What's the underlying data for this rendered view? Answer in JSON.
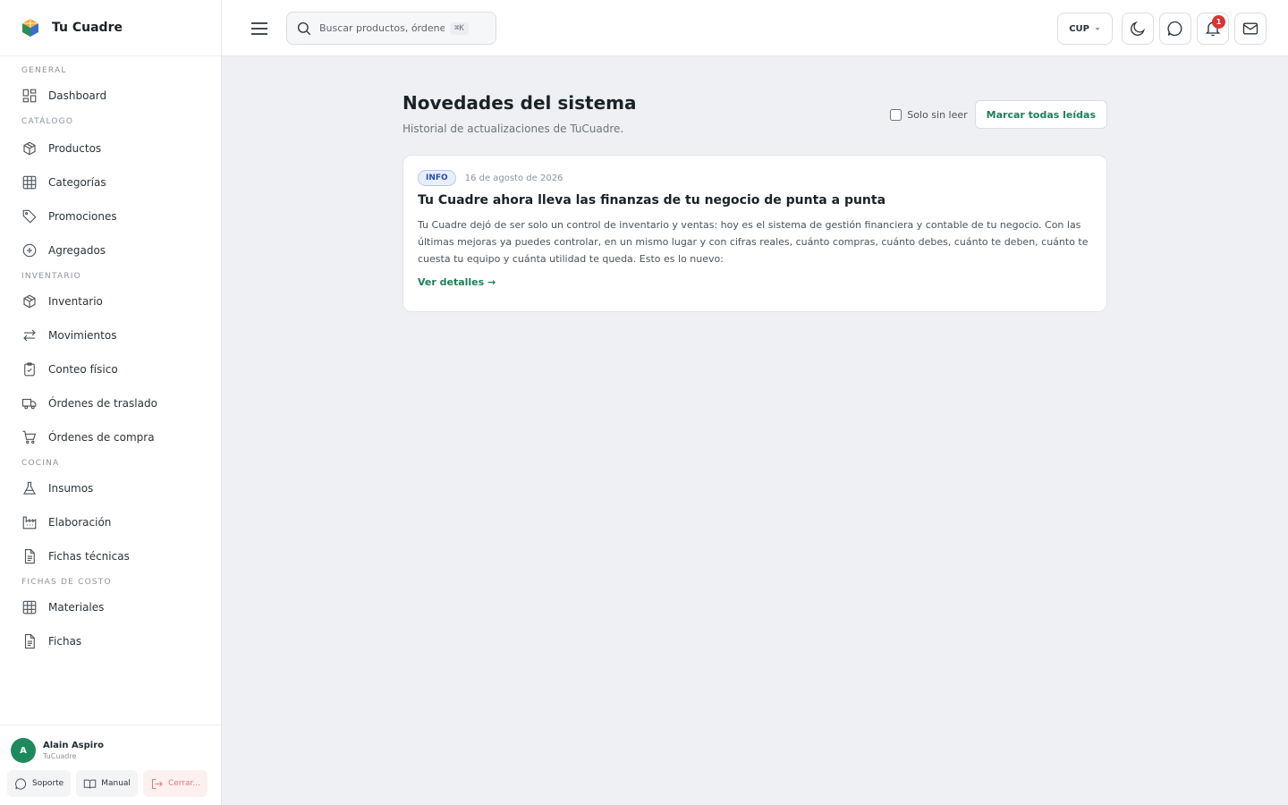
{
  "brand": {
    "name": "Tu Cuadre"
  },
  "sidebar": {
    "sections": [
      {
        "title": "GENERAL",
        "items": [
          {
            "label": "Dashboard",
            "icon": "dashboard-icon"
          }
        ]
      },
      {
        "title": "CATÁLOGO",
        "items": [
          {
            "label": "Productos",
            "icon": "box-icon"
          },
          {
            "label": "Categorías",
            "icon": "grid-icon"
          },
          {
            "label": "Promociones",
            "icon": "tag-icon"
          },
          {
            "label": "Agregados",
            "icon": "plus-circle-icon"
          }
        ]
      },
      {
        "title": "INVENTARIO",
        "items": [
          {
            "label": "Inventario",
            "icon": "box-icon"
          },
          {
            "label": "Movimientos",
            "icon": "arrows-icon"
          },
          {
            "label": "Conteo físico",
            "icon": "clipboard-icon"
          },
          {
            "label": "Órdenes de traslado",
            "icon": "truck-icon"
          },
          {
            "label": "Órdenes de compra",
            "icon": "cart-icon"
          }
        ]
      },
      {
        "title": "COCINA",
        "items": [
          {
            "label": "Insumos",
            "icon": "flask-icon"
          },
          {
            "label": "Elaboración",
            "icon": "factory-icon"
          },
          {
            "label": "Fichas técnicas",
            "icon": "document-icon"
          }
        ]
      },
      {
        "title": "FICHAS DE COSTO",
        "items": [
          {
            "label": "Materiales",
            "icon": "grid-icon"
          },
          {
            "label": "Fichas",
            "icon": "document-icon"
          }
        ]
      }
    ]
  },
  "user": {
    "initial": "A",
    "name": "Alain Aspiro",
    "org": "TuCuadre",
    "support_label": "Soporte",
    "manual_label": "Manual",
    "logout_label": "Cerrar..."
  },
  "topbar": {
    "search_placeholder": "Buscar productos, órdenes",
    "search_shortcut": "⌘K",
    "currency": "CUP",
    "notification_count": "1"
  },
  "page": {
    "title": "Novedades del sistema",
    "subtitle": "Historial de actualizaciones de TuCuadre.",
    "filter_label": "Solo sin leer",
    "mark_all_label": "Marcar todas leídas"
  },
  "news": {
    "tag": "INFO",
    "date": "16 de agosto de 2026",
    "title": "Tu Cuadre ahora lleva las finanzas de tu negocio de punta a punta",
    "body": "Tu Cuadre dejó de ser solo un control de inventario y ventas: hoy es el sistema de gestión financiera y contable de tu negocio. Con las últimas mejoras ya puedes controlar, en un mismo lugar y con cifras reales, cuánto compras, cuánto debes, cuánto te deben, cuánto te cuesta tu equipo y cuánta utilidad te queda. Esto es lo nuevo:",
    "link_label": "Ver detalles →"
  },
  "colors": {
    "accent": "#1d7f57",
    "avatar": "#1d8a5e",
    "badge": "#d93434",
    "tag_text": "#2a4da8"
  }
}
